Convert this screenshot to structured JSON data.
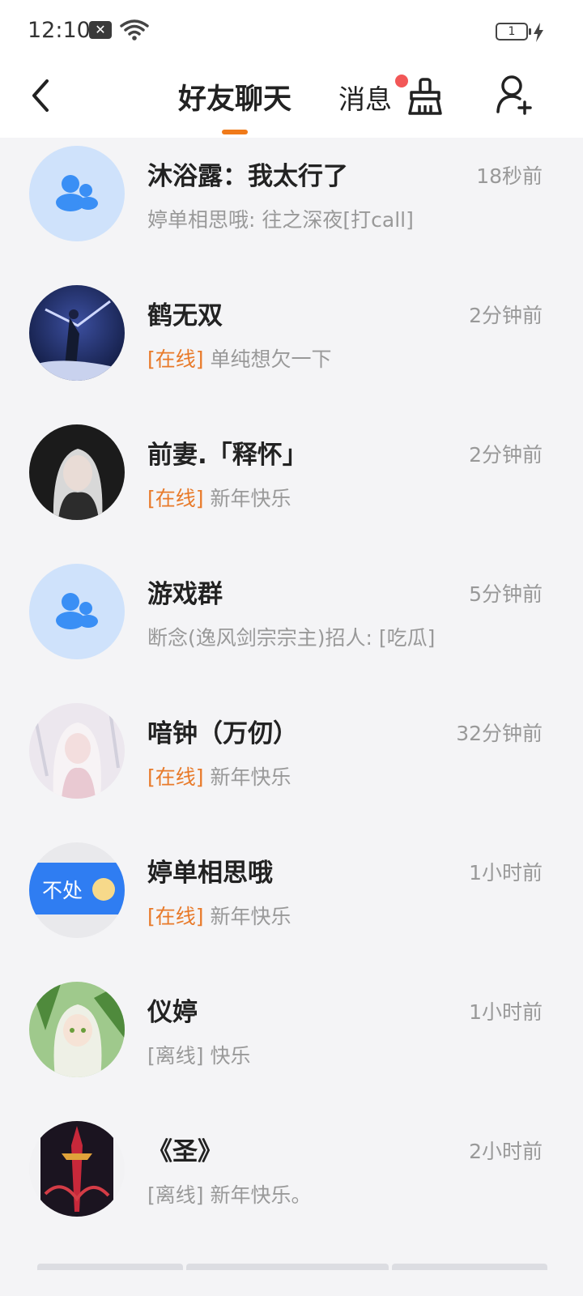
{
  "status_bar": {
    "time": "12:10",
    "notification_badge": "✕",
    "battery_level": "1",
    "icons": [
      "notification-icon",
      "wifi-icon",
      "battery-icon",
      "charging-icon"
    ]
  },
  "nav": {
    "tab_friends": "好友聊天",
    "tab_messages": "消息",
    "active_tab": "好友聊天",
    "accent_color": "#f07a1a",
    "icons": [
      "back-icon",
      "clean-icon",
      "add-friend-icon"
    ]
  },
  "chats": [
    {
      "name": "沐浴露：我太行了",
      "time": "18秒前",
      "status": "",
      "preview": "婷单相思哦: 往之深夜[打call]",
      "avatar": "group-icon"
    },
    {
      "name": "鹤无双",
      "time": "2分钟前",
      "status": "[在线]",
      "preview": "单纯想欠一下",
      "avatar": "avatar-image"
    },
    {
      "name": "前妻.「释怀」",
      "time": "2分钟前",
      "status": "[在线]",
      "preview": "新年快乐",
      "avatar": "avatar-image"
    },
    {
      "name": "游戏群",
      "time": "5分钟前",
      "status": "",
      "preview": "断念(逸风剑宗宗主)招人: [吃瓜]",
      "avatar": "group-icon"
    },
    {
      "name": "喑钟（万仞）",
      "time": "32分钟前",
      "status": "[在线]",
      "preview": "新年快乐",
      "avatar": "avatar-image"
    },
    {
      "name": "婷单相思哦",
      "time": "1小时前",
      "status": "[在线]",
      "preview": "新年快乐",
      "avatar": "avatar-image",
      "avatar_text": "不处"
    },
    {
      "name": "仪婷",
      "time": "1小时前",
      "status": "[离线]",
      "preview": "快乐",
      "avatar": "avatar-image"
    },
    {
      "name": "《圣》",
      "time": "2小时前",
      "status": "[离线]",
      "preview": "新年快乐。",
      "avatar": "avatar-image"
    }
  ],
  "colors": {
    "online": "#e87a2a",
    "offline": "#999999",
    "unread_dot": "#f25757",
    "group_avatar_bg": "#cfe2fb",
    "group_icon": "#3a8ff5"
  }
}
